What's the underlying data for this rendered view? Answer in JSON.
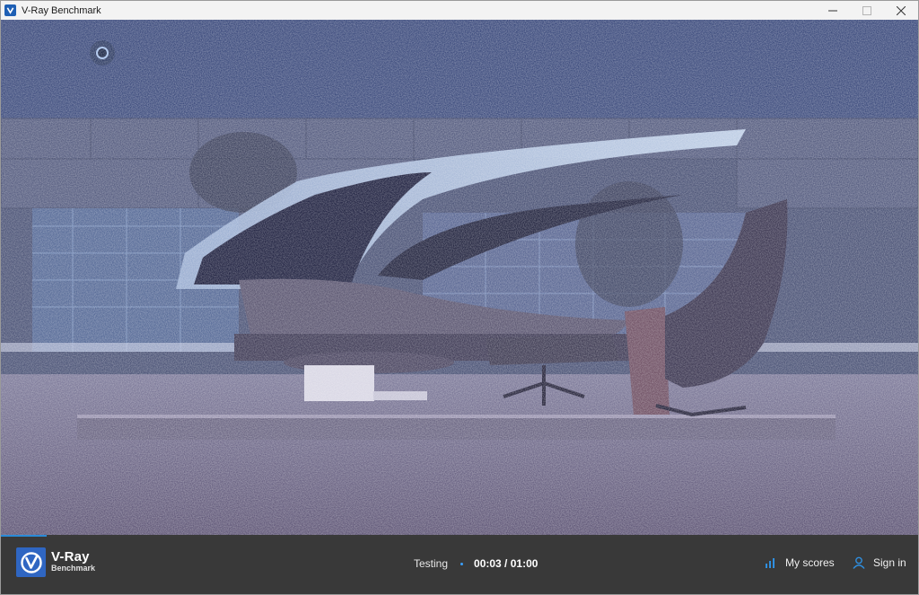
{
  "window": {
    "title": "V-Ray Benchmark",
    "controls": [
      "minimize",
      "maximize",
      "close"
    ]
  },
  "logo": {
    "name": "V-Ray",
    "subtitle": "Benchmark"
  },
  "status": {
    "label": "Testing",
    "timer": "00:03 / 01:00",
    "progress_fraction": 0.05
  },
  "nav": {
    "my_scores": "My scores",
    "sign_in": "Sign in"
  },
  "colors": {
    "accent": "#2a8bd8",
    "brand_blue": "#2f66c2",
    "bottom_bar": "#393939"
  },
  "icons": [
    "vray-logo-icon",
    "minimize-icon",
    "maximize-icon",
    "close-icon",
    "bar-chart-icon",
    "user-icon"
  ]
}
